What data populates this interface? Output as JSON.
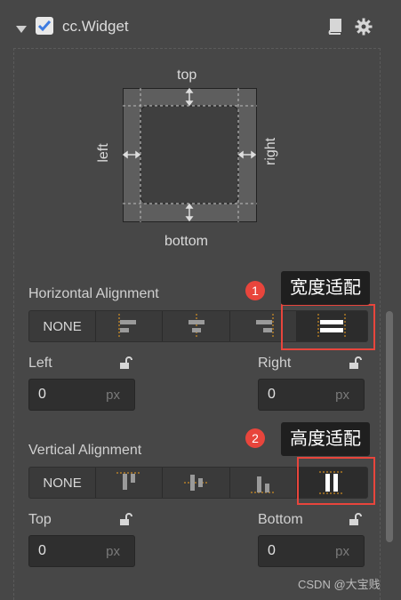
{
  "header": {
    "component_name": "cc.Widget",
    "enabled": true
  },
  "preview": {
    "top": "top",
    "left": "left",
    "right": "right",
    "bottom": "bottom"
  },
  "horizontal": {
    "label": "Horizontal Alignment",
    "none_label": "NONE",
    "left_label": "Left",
    "right_label": "Right",
    "left_value": "0",
    "right_value": "0",
    "unit": "px"
  },
  "vertical": {
    "label": "Vertical Alignment",
    "none_label": "NONE",
    "top_label": "Top",
    "bottom_label": "Bottom",
    "top_value": "0",
    "bottom_value": "0",
    "unit": "px"
  },
  "annotations": {
    "badge1": "1",
    "tip1": "宽度适配",
    "badge2": "2",
    "tip2": "高度适配"
  },
  "watermark": "CSDN @大宝贱",
  "colors": {
    "accent": "#f0a020",
    "marker": "#e8453c",
    "check": "#3d7be0"
  }
}
